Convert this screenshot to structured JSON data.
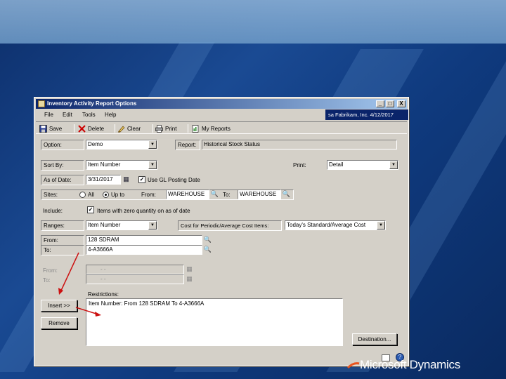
{
  "window": {
    "title": "Inventory Activity Report Options",
    "company": "sa Fabrikam, Inc. 4/12/2017",
    "controls": {
      "minimize": "_",
      "maximize": "□",
      "close": "X"
    }
  },
  "menu": {
    "file": "File",
    "edit": "Edit",
    "tools": "Tools",
    "help": "Help"
  },
  "toolbar": {
    "save": "Save",
    "delete": "Delete",
    "clear": "Clear",
    "print": "Print",
    "my_reports": "My Reports",
    "icons": [
      "save-icon",
      "delete-icon",
      "clear-icon",
      "print-icon",
      "my-reports-icon"
    ]
  },
  "form": {
    "option_label": "Option:",
    "option_value": "Demo",
    "report_label": "Report:",
    "report_value": "Historical Stock Status",
    "sort_by_label": "Sort By:",
    "sort_by_value": "Item Number",
    "print_label": "Print:",
    "print_value": "Detail",
    "as_of_date_label": "As of Date:",
    "as_of_date_value": "3/31/2017",
    "use_gl_posting_date": "Use GL Posting Date",
    "use_gl_checked": "✓",
    "sites_label": "Sites:",
    "sites_all": "All",
    "sites_from_radio": "Up to",
    "sites_from_label": "From:",
    "sites_from_value": "WAREHOUSE",
    "sites_to_label": "To:",
    "sites_to_value": "WAREHOUSE",
    "include_label": "Include:",
    "include_zero_qty": "Items with zero quantity on as of date",
    "include_checked": "✓",
    "ranges_label": "Ranges:",
    "ranges_value": "Item Number",
    "cost_label": "Cost for Periodic/Average Cost Items:",
    "cost_value": "Today's Standard/Average Cost",
    "range_from_label": "From:",
    "range_from_value": "128 SDRAM",
    "range_to_label": "To:",
    "range_to_value": "4-A3666A",
    "disabled_from_label": "From:",
    "disabled_to_label": "To:",
    "disabled_from_value": "- -",
    "disabled_to_value": "- -",
    "restrictions_label": "Restrictions:",
    "restriction_items": [
      "Item Number: From 128 SDRAM To 4-A3666A"
    ],
    "insert_button": "Insert >>",
    "remove_button": "Remove",
    "destination_button": "Destination..."
  },
  "branding": {
    "logo_text": "Microsoft Dynamics",
    "logo_icon": "dynamics-logo-icon"
  },
  "colors": {
    "titlebar": "#0a246a",
    "window_face": "#d4d0c8",
    "annotation_arrow": "#cc1111"
  }
}
